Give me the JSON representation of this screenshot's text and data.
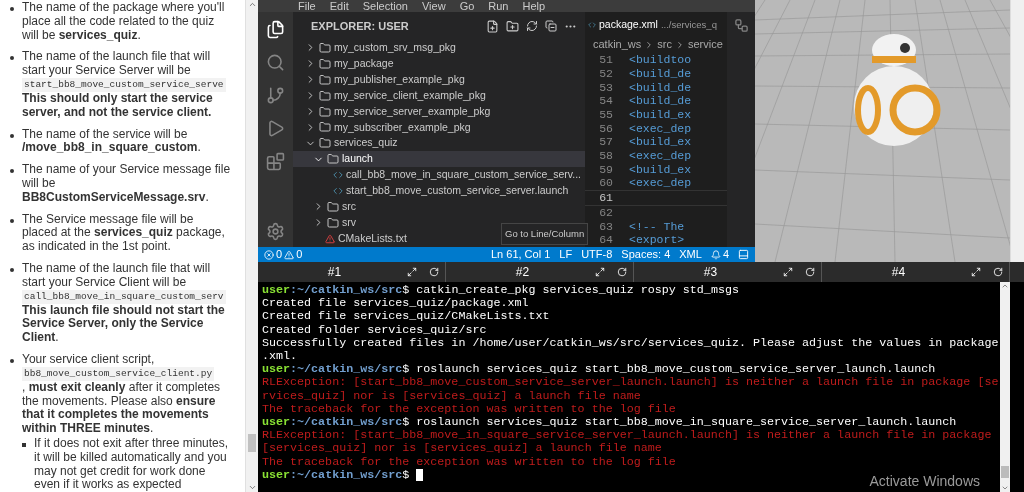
{
  "instructions": [
    {
      "blocks": [
        {
          "kind": "text",
          "text": "The name of the package where you'll place all the code related to the quiz will be **services_quiz**."
        }
      ]
    },
    {
      "blocks": [
        {
          "kind": "text",
          "text": "The name of the launch file that will start your Service Server will be"
        },
        {
          "kind": "code",
          "text": "start_bb8_move_custom_service_serve"
        },
        {
          "kind": "text",
          "text": "**This should only start the service server, and not the service client.**"
        }
      ]
    },
    {
      "blocks": [
        {
          "kind": "text",
          "text": "The name of the service will be **/move_bb8_in_square_custom**."
        }
      ]
    },
    {
      "blocks": [
        {
          "kind": "text",
          "text": "The name of your Service message file will be **BB8CustomServiceMessage.srv**."
        }
      ]
    },
    {
      "blocks": [
        {
          "kind": "text",
          "text": "The Service message file will be placed at the **services_quiz** package, as indicated in the 1st point."
        }
      ]
    },
    {
      "blocks": [
        {
          "kind": "text",
          "text": "The name of the launch file that will start your Service Client will be"
        },
        {
          "kind": "code",
          "text": "call_bb8_move_in_square_custom_serv"
        },
        {
          "kind": "text",
          "text": "**This launch file should not start the Service Server, only the Service Client**."
        }
      ]
    },
    {
      "blocks": [
        {
          "kind": "text",
          "text": "Your service client script,"
        },
        {
          "kind": "code",
          "text": "bb8_move_custom_service_client.py"
        },
        {
          "kind": "text",
          "text": ", **must exit cleanly** after it completes the movements. Please also **ensure that it completes the movements within THREE minutes**."
        }
      ],
      "children": [
        {
          "blocks": [
            {
              "kind": "text",
              "text": "If it does not exit after three minutes, it will be killed automatically and you may not get credit for work done even if it works as expected"
            }
          ]
        }
      ]
    }
  ],
  "editor_window": {
    "menu": [
      "File",
      "Edit",
      "Selection",
      "View",
      "Go",
      "Run",
      "Help"
    ],
    "explorer_title": "EXPLORER: USER",
    "tree": [
      {
        "kind": "folder",
        "name": "my_custom_srv_msg_pkg",
        "expanded": false,
        "selected": false
      },
      {
        "kind": "folder",
        "name": "my_package",
        "expanded": false,
        "selected": false
      },
      {
        "kind": "folder",
        "name": "my_publisher_example_pkg",
        "expanded": false,
        "selected": false
      },
      {
        "kind": "folder",
        "name": "my_service_client_example_pkg",
        "expanded": false,
        "selected": false
      },
      {
        "kind": "folder",
        "name": "my_service_server_example_pkg",
        "expanded": false,
        "selected": false
      },
      {
        "kind": "folder",
        "name": "my_subscriber_example_pkg",
        "expanded": false,
        "selected": false
      },
      {
        "kind": "folder",
        "name": "services_quiz",
        "expanded": true,
        "selected": false,
        "children": [
          {
            "kind": "folder",
            "name": "launch",
            "expanded": true,
            "selected": true,
            "children": [
              {
                "kind": "launch-file",
                "name": "call_bb8_move_in_square_custom_service_serv...",
                "selected": false
              },
              {
                "kind": "launch-file",
                "name": "start_bb8_move_custom_service_server.launch",
                "selected": false
              }
            ]
          },
          {
            "kind": "folder",
            "name": "src",
            "expanded": false,
            "selected": false
          },
          {
            "kind": "folder",
            "name": "srv",
            "expanded": false,
            "selected": false
          },
          {
            "kind": "cmake-file",
            "name": "CMakeLists.txt",
            "selected": false
          }
        ]
      }
    ],
    "tab": {
      "name": "package.xml",
      "path": ".../services_q"
    },
    "breadcrumb": [
      "catkin_ws",
      "src",
      "service"
    ],
    "lines": [
      {
        "number": "51",
        "code": "<buildtoo",
        "current": false
      },
      {
        "number": "52",
        "code": "<build_de",
        "current": false
      },
      {
        "number": "53",
        "code": "<build_de",
        "current": false
      },
      {
        "number": "54",
        "code": "<build_de",
        "current": false
      },
      {
        "number": "55",
        "code": "<build_ex",
        "current": false
      },
      {
        "number": "56",
        "code": "<exec_dep",
        "current": false
      },
      {
        "number": "57",
        "code": "<build_ex",
        "current": false
      },
      {
        "number": "58",
        "code": "<exec_dep",
        "current": false
      },
      {
        "number": "59",
        "code": "<build_ex",
        "current": false
      },
      {
        "number": "60",
        "code": "<exec_dep",
        "current": false
      },
      {
        "number": "61",
        "current": true
      },
      {
        "number": "62",
        "current": false
      },
      {
        "number": "63",
        "code": "<!-- The",
        "current": false
      },
      {
        "number": "64",
        "code": "<export>",
        "current": false
      }
    ],
    "tooltip": "Go to Line/Column",
    "status": {
      "errors": "0",
      "warnings": "0",
      "items": [
        "Ln 61, Col 1",
        "LF",
        "UTF-8",
        "Spaces: 4",
        "XML"
      ],
      "notifications": "4"
    }
  },
  "terminal": {
    "tabs": [
      "#1",
      "#2",
      "#3",
      "#4"
    ],
    "lines": [
      {
        "kind": "prompt",
        "user": "user",
        "path": ":~/catkin_ws/src",
        "command": "$ catkin_create_pkg services_quiz rospy std_msgs"
      },
      {
        "kind": "output",
        "text": "Created file services_quiz/package.xml"
      },
      {
        "kind": "output",
        "text": "Created file services_quiz/CMakeLists.txt"
      },
      {
        "kind": "output",
        "text": "Created folder services_quiz/src"
      },
      {
        "kind": "output",
        "text": "Successfully created files in /home/user/catkin_ws/src/services_quiz. Please adjust the values in package"
      },
      {
        "kind": "output",
        "text": ".xml."
      },
      {
        "kind": "prompt",
        "user": "user",
        "path": ":~/catkin_ws/src",
        "command": "$ roslaunch services_quiz start_bb8_move_custom_service_server_launch.launch"
      },
      {
        "kind": "error",
        "text": "RLException: [start_bb8_move_custom_service_server_launch.launch] is neither a launch file in package [se"
      },
      {
        "kind": "error",
        "text": "rvices_quiz] nor is [services_quiz] a launch file name"
      },
      {
        "kind": "error",
        "text": "The traceback for the exception was written to the log file"
      },
      {
        "kind": "prompt",
        "user": "user",
        "path": ":~/catkin_ws/src",
        "command": "$ roslaunch services_quiz start_bb8_move_in_square_service_server_launch.launch"
      },
      {
        "kind": "error",
        "text": "RLException: [start_bb8_move_in_square_service_server_launch.launch] is neither a launch file in package"
      },
      {
        "kind": "error",
        "text": "[services_quiz] nor is [services_quiz] a launch file name"
      },
      {
        "kind": "error",
        "text": "The traceback for the exception was written to the log file"
      },
      {
        "kind": "prompt",
        "user": "user",
        "path": ":~/catkin_ws/src",
        "command": "$",
        "cursor": true
      }
    ]
  },
  "os_notice": "Activate Windows"
}
